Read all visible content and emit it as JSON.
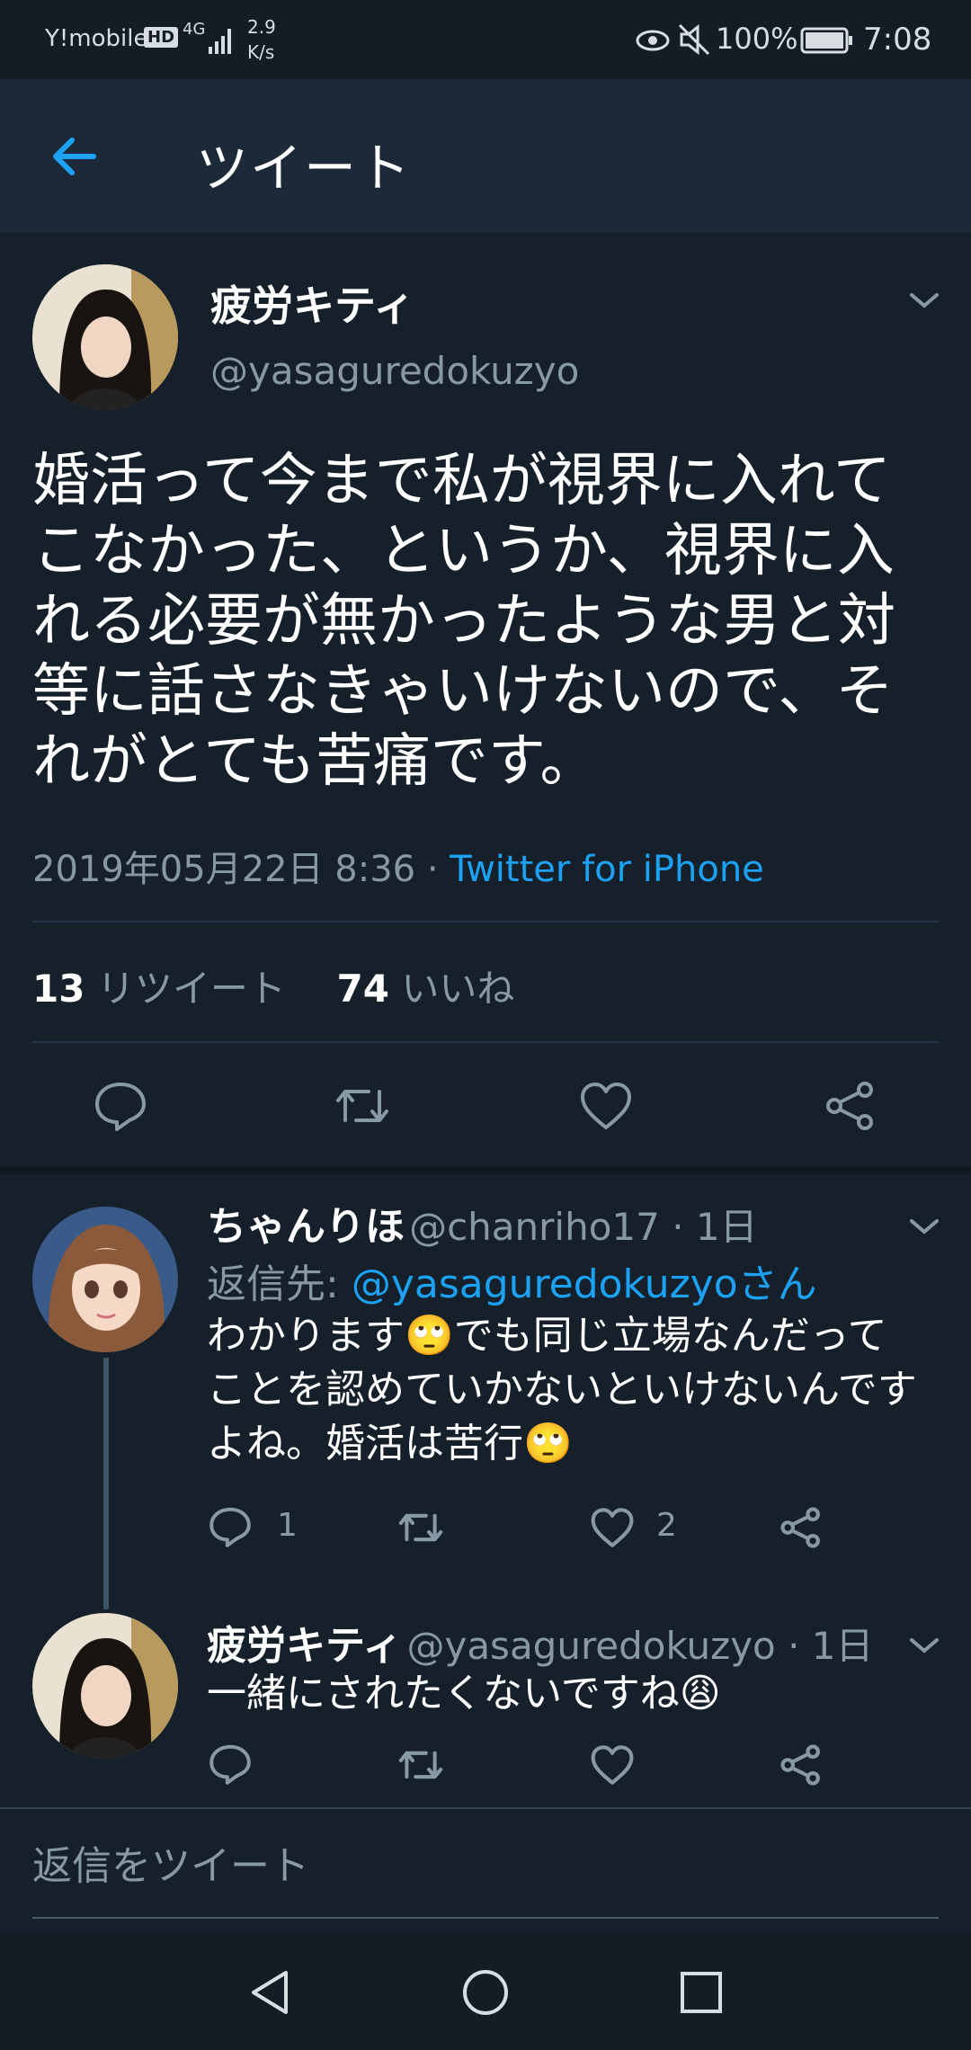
{
  "status_bar": {
    "carrier": "Y!mobile",
    "hd_badge": "HD",
    "network": "4G",
    "speed_value": "2.9",
    "speed_unit": "K/s",
    "battery": "100%",
    "time": "7:08"
  },
  "header": {
    "title": "ツイート"
  },
  "main_tweet": {
    "display_name": "疲労キティ",
    "handle": "@yasaguredokuzyo",
    "text_lines": [
      "婚活って今まで私が視界に入れて",
      "こなかった、というか、視界に入",
      "れる必要が無かったような男と対",
      "等に話さなきゃいけないので、そ",
      "れがとても苦痛です。"
    ],
    "timestamp": "2019年05月22日 8:36 · ",
    "source": "Twitter for iPhone",
    "retweet_count": "13",
    "retweet_label": "リツイート",
    "like_count": "74",
    "like_label": "いいね"
  },
  "replies": [
    {
      "display_name": "ちゃんりほ",
      "handle": "@chanriho17 · 1日",
      "reply_to_label": "返信先: ",
      "reply_to_handle": "@yasaguredokuzyoさん",
      "text_lines": [
        "わかります🙄でも同じ立場なんだって",
        "ことを認めていかないといけないんです",
        "よね。婚活は苦行🙄"
      ],
      "reply_count": "1",
      "like_count": "2"
    },
    {
      "display_name": "疲労キティ",
      "handle": "@yasaguredokuzyo · 1日",
      "text_lines": [
        "一緒にされたくないですね😩"
      ]
    }
  ],
  "compose": {
    "placeholder": "返信をツイート"
  },
  "colors": {
    "background": "#15202b",
    "header": "#1c2938",
    "accent": "#1da1f2",
    "muted": "#8899a6"
  },
  "icons": [
    "back-arrow-icon",
    "chevron-down-icon",
    "reply-icon",
    "retweet-icon",
    "like-icon",
    "share-icon",
    "nav-back-icon",
    "nav-home-icon",
    "nav-recents-icon"
  ]
}
